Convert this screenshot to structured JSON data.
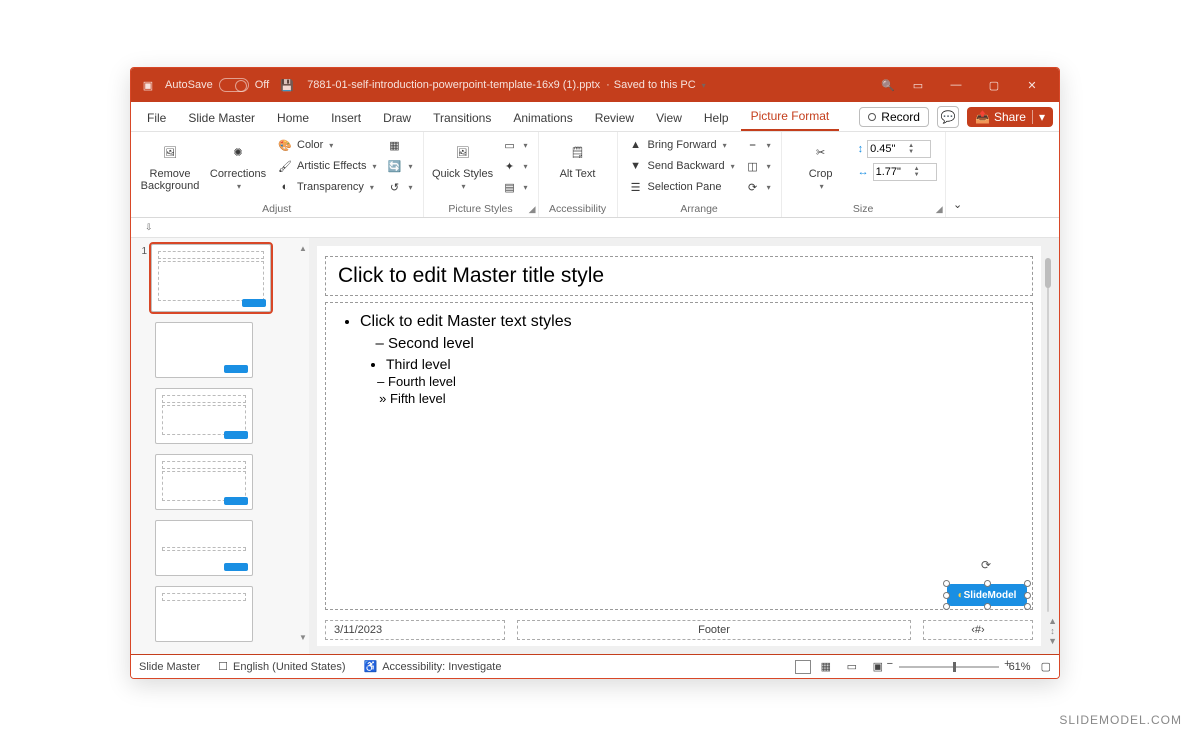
{
  "titlebar": {
    "autosave_label": "AutoSave",
    "autosave_state": "Off",
    "document_name": "7881-01-self-introduction-powerpoint-template-16x9 (1).pptx",
    "save_status": "Saved to this PC"
  },
  "menubar": {
    "items": [
      "File",
      "Slide Master",
      "Home",
      "Insert",
      "Draw",
      "Transitions",
      "Animations",
      "Review",
      "View",
      "Help",
      "Picture Format"
    ],
    "active": "Picture Format",
    "record": "Record",
    "share": "Share"
  },
  "ribbon": {
    "adjust": {
      "remove_bg": "Remove Background",
      "corrections": "Corrections",
      "color": "Color",
      "artistic": "Artistic Effects",
      "transparency": "Transparency",
      "label": "Adjust"
    },
    "picture_styles": {
      "quick_styles": "Quick Styles",
      "label": "Picture Styles"
    },
    "accessibility": {
      "alt_text": "Alt Text",
      "label": "Accessibility"
    },
    "arrange": {
      "bring_forward": "Bring Forward",
      "send_backward": "Send Backward",
      "selection_pane": "Selection Pane",
      "label": "Arrange"
    },
    "size": {
      "crop": "Crop",
      "height": "0.45\"",
      "width": "1.77\"",
      "label": "Size"
    }
  },
  "thumbnails": {
    "selected_index": 1
  },
  "slide": {
    "title_placeholder": "Click to edit Master title style",
    "body_l1": "Click to edit Master text styles",
    "body_l2": "Second level",
    "body_l3": "Third level",
    "body_l4": "Fourth level",
    "body_l5": "Fifth level",
    "date": "3/11/2023",
    "footer": "Footer",
    "slide_number": "‹#›",
    "selected_picture_label": "SlideModel"
  },
  "statusbar": {
    "view": "Slide Master",
    "language": "English (United States)",
    "accessibility": "Accessibility: Investigate",
    "zoom": "61%"
  },
  "watermark": "SLIDEMODEL.COM"
}
